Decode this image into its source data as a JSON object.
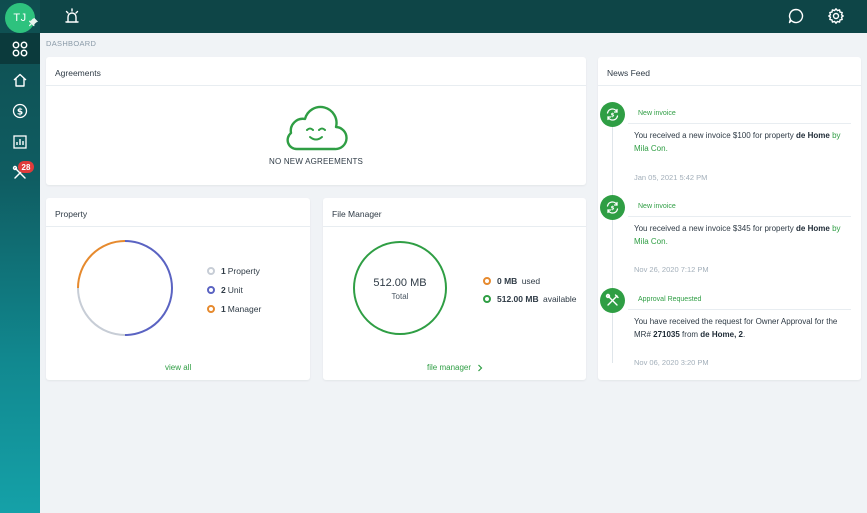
{
  "user": {
    "initials": "TJ"
  },
  "sidebar": {
    "items": [
      {
        "name": "dashboard",
        "icon": "grid-circles-icon",
        "active": true
      },
      {
        "name": "home",
        "icon": "home-icon"
      },
      {
        "name": "payments",
        "icon": "dollar-circle-icon"
      },
      {
        "name": "reports",
        "icon": "bar-chart-icon"
      },
      {
        "name": "maintenance",
        "icon": "tools-icon",
        "badge": "28"
      }
    ]
  },
  "breadcrumb": "DASHBOARD",
  "agreements": {
    "title": "Agreements",
    "empty_text": "NO NEW AGREEMENTS"
  },
  "property": {
    "title": "Property",
    "legend": [
      {
        "count": "1",
        "label": "Property",
        "color": "#c7cdd6"
      },
      {
        "count": "2",
        "label": "Unit",
        "color": "#5a63c2"
      },
      {
        "count": "1",
        "label": "Manager",
        "color": "#e68a2e"
      }
    ],
    "link": "view all"
  },
  "file_manager": {
    "title": "File Manager",
    "size": "512.00 MB",
    "total_label": "Total",
    "used_value": "0 MB",
    "used_label": "used",
    "available_value": "512.00 MB",
    "available_label": "available",
    "link": "file manager",
    "link_icon": "chevron-right-icon"
  },
  "news": {
    "title": "News Feed",
    "items": [
      {
        "type": "New invoice",
        "icon": "invoice-arrows-icon",
        "text_pre": "You received a new invoice $100 for property ",
        "bold": "de Home",
        "by": "by Mila Con.",
        "date": "Jan 05, 2021 5:42 PM"
      },
      {
        "type": "New invoice",
        "icon": "invoice-arrows-icon",
        "text_pre": "You received a new invoice $345 for property ",
        "bold": "de Home",
        "by": "by Mila Con.",
        "date": "Nov 26, 2020 7:12 PM"
      },
      {
        "type": "Approval Requested",
        "icon": "tools-icon",
        "text_pre": "You have received the request for Owner Approval for the MR# ",
        "mr": "271035",
        "from": " from ",
        "bold": "de Home, 2",
        "end": ".",
        "date": "Nov 06, 2020 3:20 PM"
      }
    ]
  },
  "colors": {
    "accent_green": "#2f9e44",
    "header_bg": "#0e4547",
    "badge_red": "#e03b3b"
  }
}
